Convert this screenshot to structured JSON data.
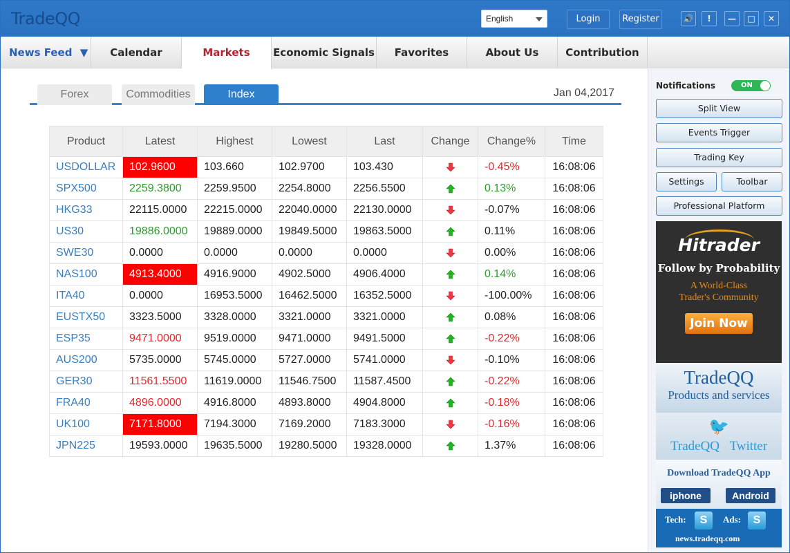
{
  "app": {
    "logo": "TradeQQ",
    "language": "English",
    "login_label": "Login",
    "register_label": "Register"
  },
  "window_buttons": [
    "sound",
    "alert",
    "minimize",
    "maximize",
    "close"
  ],
  "nav": {
    "items": [
      {
        "label": "News Feed",
        "active": false
      },
      {
        "label": "Calendar",
        "active": false
      },
      {
        "label": "Markets",
        "active": true
      },
      {
        "label": "Economic Signals",
        "active": false
      },
      {
        "label": "Favorites",
        "active": false
      },
      {
        "label": "About Us",
        "active": false
      },
      {
        "label": "Contribution",
        "active": false
      }
    ]
  },
  "markets": {
    "tabs": [
      {
        "label": "Forex",
        "active": false
      },
      {
        "label": "Commodities",
        "active": false
      },
      {
        "label": "Index",
        "active": true
      }
    ],
    "date": "Jan 04,2017",
    "columns": [
      "Product",
      "Latest",
      "Highest",
      "Lowest",
      "Last",
      "Change",
      "Change%",
      "Time"
    ],
    "rows": [
      {
        "product": "USDOLLAR",
        "latest": "102.9600",
        "latest_style": "bg-red",
        "highest": "103.660",
        "lowest": "102.9700",
        "last": "103.430",
        "direction": "down",
        "change_pct": "-0.45%",
        "pct_style": "red",
        "time": "16:08:06"
      },
      {
        "product": "SPX500",
        "latest": "2259.3800",
        "latest_style": "green",
        "highest": "2259.9500",
        "lowest": "2254.8000",
        "last": "2256.5500",
        "direction": "up",
        "change_pct": "0.13%",
        "pct_style": "green",
        "time": "16:08:06"
      },
      {
        "product": "HKG33",
        "latest": "22115.0000",
        "latest_style": "",
        "highest": "22215.0000",
        "lowest": "22040.0000",
        "last": "22130.0000",
        "direction": "down",
        "change_pct": "-0.07%",
        "pct_style": "",
        "time": "16:08:06"
      },
      {
        "product": "US30",
        "latest": "19886.0000",
        "latest_style": "green",
        "highest": "19889.0000",
        "lowest": "19849.5000",
        "last": "19863.5000",
        "direction": "up",
        "change_pct": "0.11%",
        "pct_style": "",
        "time": "16:08:06"
      },
      {
        "product": "SWE30",
        "latest": "0.0000",
        "latest_style": "",
        "highest": "0.0000",
        "lowest": "0.0000",
        "last": "0.0000",
        "direction": "down",
        "change_pct": "0.00%",
        "pct_style": "",
        "time": "16:08:06"
      },
      {
        "product": "NAS100",
        "latest": "4913.4000",
        "latest_style": "bg-red",
        "highest": "4916.9000",
        "lowest": "4902.5000",
        "last": "4906.4000",
        "direction": "up",
        "change_pct": "0.14%",
        "pct_style": "green",
        "time": "16:08:06"
      },
      {
        "product": "ITA40",
        "latest": "0.0000",
        "latest_style": "",
        "highest": "16953.5000",
        "lowest": "16462.5000",
        "last": "16352.5000",
        "direction": "down",
        "change_pct": "-100.00%",
        "pct_style": "",
        "time": "16:08:06"
      },
      {
        "product": "EUSTX50",
        "latest": "3323.5000",
        "latest_style": "",
        "highest": "3328.0000",
        "lowest": "3321.0000",
        "last": "3321.0000",
        "direction": "up",
        "change_pct": "0.08%",
        "pct_style": "",
        "time": "16:08:06"
      },
      {
        "product": "ESP35",
        "latest": "9471.0000",
        "latest_style": "red",
        "highest": "9519.0000",
        "lowest": "9471.0000",
        "last": "9491.5000",
        "direction": "up",
        "change_pct": "-0.22%",
        "pct_style": "red",
        "time": "16:08:06"
      },
      {
        "product": "AUS200",
        "latest": "5735.0000",
        "latest_style": "",
        "highest": "5745.0000",
        "lowest": "5727.0000",
        "last": "5741.0000",
        "direction": "down",
        "change_pct": "-0.10%",
        "pct_style": "",
        "time": "16:08:06"
      },
      {
        "product": "GER30",
        "latest": "11561.5500",
        "latest_style": "red",
        "highest": "11619.0000",
        "lowest": "11546.7500",
        "last": "11587.4500",
        "direction": "up",
        "change_pct": "-0.22%",
        "pct_style": "red",
        "time": "16:08:06"
      },
      {
        "product": "FRA40",
        "latest": "4896.0000",
        "latest_style": "red",
        "highest": "4916.8000",
        "lowest": "4893.8000",
        "last": "4904.8000",
        "direction": "up",
        "change_pct": "-0.18%",
        "pct_style": "red",
        "time": "16:08:06"
      },
      {
        "product": "UK100",
        "latest": "7171.8000",
        "latest_style": "bg-red",
        "highest": "7194.3000",
        "lowest": "7169.2000",
        "last": "7183.3000",
        "direction": "down",
        "change_pct": "-0.16%",
        "pct_style": "red",
        "time": "16:08:06"
      },
      {
        "product": "JPN225",
        "latest": "19593.0000",
        "latest_style": "",
        "highest": "19635.5000",
        "lowest": "19280.5000",
        "last": "19328.0000",
        "direction": "up",
        "change_pct": "1.37%",
        "pct_style": "",
        "time": "16:08:06"
      }
    ]
  },
  "sidebar": {
    "notifications_label": "Notifications",
    "notifications_state": "ON",
    "buttons": {
      "split_view": "Split View",
      "events_trigger": "Events Trigger",
      "trading_key": "Trading Key",
      "settings": "Settings",
      "toolbar": "Toolbar",
      "professional_platform": "Professional Platform"
    },
    "ad_hitrader": {
      "brand": "Hitrader",
      "headline": "Follow by Probability",
      "line1": "A World-Class",
      "line2": "Trader's Community",
      "cta": "Join Now"
    },
    "ad_products": {
      "title": "TradeQQ",
      "subtitle": "Products and services"
    },
    "ad_twitter": {
      "left": "TradeQQ",
      "right": "Twitter"
    },
    "ad_app": {
      "title": "Download TradeQQ App",
      "iphone": "iphone",
      "android": "Android"
    },
    "ad_contact": {
      "tech": "Tech:",
      "ads": "Ads:",
      "url": "news.tradeqq.com"
    }
  },
  "colors": {
    "brand_blue": "#2b72c2",
    "active_nav": "#b2232f",
    "up": "#2e9a2e",
    "down": "#e5262e",
    "tab_active": "#2f80cc"
  }
}
